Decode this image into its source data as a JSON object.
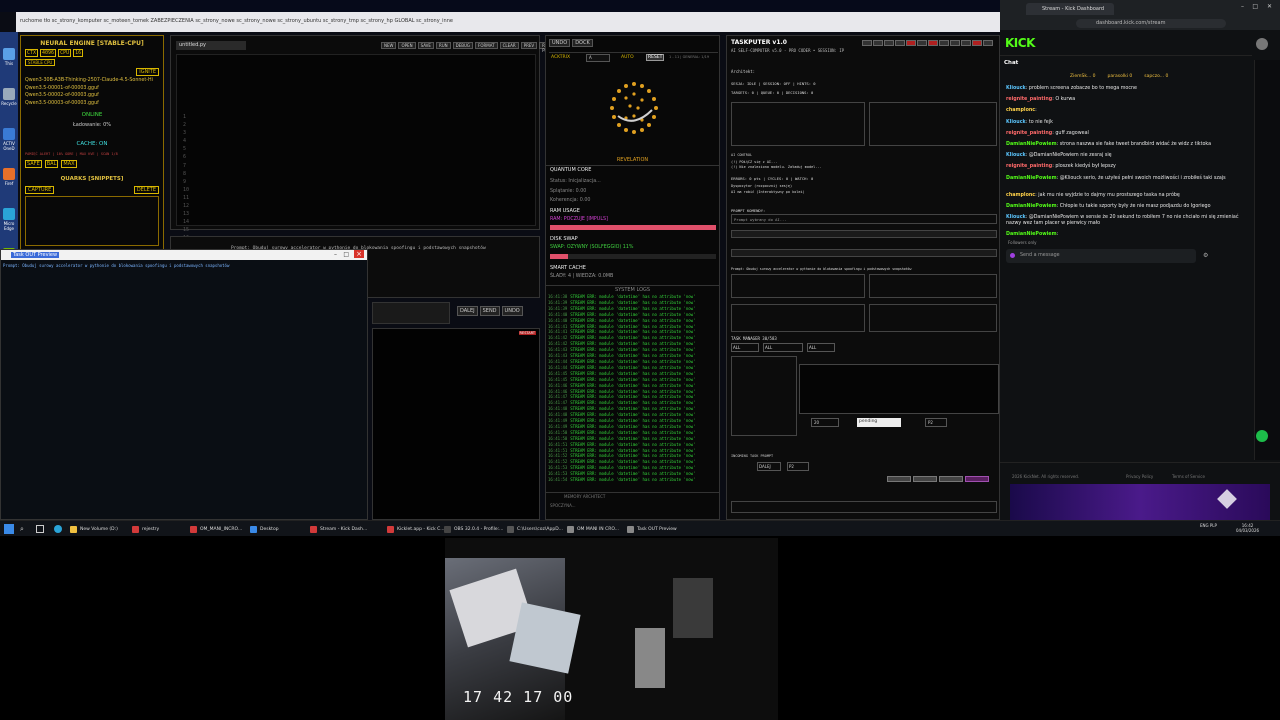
{
  "browser": {
    "bookmark_links": "ruchome tło   sc_strony_komputer   sc_moteen_tomek   ZABEZPIECZENIA   sc_strony_nowe   sc_strony_nowe   sc_strony_ubuntu   sc_strony_tmp   sc_strony_hp   GLOBAL   sc_strony_inne"
  },
  "desktop_icons": [
    {
      "label": "This",
      "color": "#5aa0e8"
    },
    {
      "label": "Recycle",
      "color": "#9ab"
    },
    {
      "label": "ACTIV OneD",
      "color": "#3a7bd5"
    },
    {
      "label": "Firef",
      "color": "#e8702a"
    },
    {
      "label": "Micro Edge",
      "color": "#2aa4d8"
    },
    {
      "label": "NVIDIA",
      "color": "#76b900"
    }
  ],
  "neural": {
    "title": "NEURAL ENGINE [STABLE-CPU]",
    "buttons": [
      "CTX",
      "4096",
      "CPU",
      "16"
    ],
    "stable": "STABLE CPU",
    "ignite": "IGNITE",
    "models": [
      "Qwen3-30B-A3B-Thinking-2507-Claude-4.5-Sonnet-Hi",
      "Qwen3.5-00001-of-00003.gguf",
      "Qwen3.5-00002-of-00003.gguf",
      "Qwen3.5-00003-of-00003.gguf"
    ],
    "status": "ONLINE",
    "loading": "Ładowanie: 0%",
    "cache": "CACHE: ON",
    "cache_stats": "PAMIĘĆ ALERT  |  10% GORE  |  MAX KVE  |  SCAN 1/8",
    "cache_buttons": [
      "SAFE",
      "BAL",
      "MAX"
    ],
    "quarks_title": "QUARKS [SNIPPETS]",
    "capture": "CAPTURE",
    "delete": "DELETE"
  },
  "editor": {
    "tab": "untitled.py",
    "toolbar": [
      "NEW",
      "OPEN",
      "SAVE",
      "RUN",
      "DEBUG",
      "FORMAT",
      "CLEAR",
      "PREV",
      "RUN PROMPT"
    ],
    "line_numbers": "1\n2\n3\n4\n5\n6\n7\n8\n9\n10\n11\n12\n13\n14\n15\n16\n17\n18\n19",
    "prompt_text": "Prompt: Obuduj surowy accelerator w pythonie do blokowania spoofingu i podstawowych snapshotów",
    "nav_buttons": [
      "DALEJ",
      "SEND",
      "UNDO"
    ],
    "restart": "RESTART"
  },
  "preview_window": {
    "title": "Task OUT Preview",
    "controls": [
      "–",
      "□",
      "×"
    ],
    "text": "Prompt: Obuduj surowy accelerator w pythonie do blokowania spoofingu i podstawowych snapshotów"
  },
  "middle": {
    "undo": "UNDO",
    "dock": "DOCK",
    "actrix": "ACKTRIX",
    "auto": "AUTO",
    "reset": "RESET",
    "mode": "A",
    "counts": "1 - 11  |  GENERAL: 1/19",
    "revelation": "REVELATION",
    "quantum_title": "QUANTUM CORE",
    "quantum_lines": [
      "Status: Inicjalizacja...",
      "Splątanie: 0.00",
      "Koherencja: 0.00"
    ],
    "ram_title": "RAM USAGE",
    "ram_value": "RAM: POCZUJE [IMPULS]",
    "swap_title": "DISK SWAP",
    "swap_value": "SWAP: OZYWNY (SOLFEGGIO) 11%",
    "smart_title": "SMART CACHE",
    "smart_value": "ŚLADY: 4  |  WIEDZA: 0.0MB",
    "log_title": "SYSTEM LOGS",
    "log_times": [
      "16:41:38",
      "16:41:39",
      "16:41:39",
      "16:41:40",
      "16:41:40",
      "16:41:41",
      "16:41:41",
      "16:41:42",
      "16:41:42",
      "16:41:43",
      "16:41:43",
      "16:41:44",
      "16:41:44",
      "16:41:45",
      "16:41:45",
      "16:41:46",
      "16:41:46",
      "16:41:47",
      "16:41:47",
      "16:41:48",
      "16:41:48",
      "16:41:49",
      "16:41:49",
      "16:41:50",
      "16:41:50",
      "16:41:51",
      "16:41:51",
      "16:41:52",
      "16:41:52",
      "16:41:53",
      "16:41:53",
      "16:41:54"
    ],
    "log_msg": "STREAM ERR: module 'datetime' has no attribute 'now'",
    "memory_title": "MEMORY ARCHITECT",
    "memory_value": "SPOCZYNA..."
  },
  "taskputer": {
    "title": "TASKPUTER v1.0",
    "sub": "AI SELF-COMPUTER v5.0 - PRO CODER • SESSION: IP",
    "architect": "Architekt:",
    "session_line": "SESJA: IDLE  |  SESSION: OFF  |  HINTS: 0",
    "targets": "TARGETS: 0  |  QUEUE: 0  |  DECISIONS: 0",
    "ai_control": "AI CONTROL",
    "control_lines": [
      "(!) POŁĄCZ się z AI...",
      "(!) Nie znaleziono modelu. Załaduj model..."
    ],
    "errors_line": "ERRORS: 0 pts  |  CYCLES: 0  |  WATCH: 0",
    "dispatch": "Dyspozytor (rozpocznij sesję)",
    "dispatch2": "AI ma robić (Interaktywny po kolei)",
    "prompt_label": "PROMPT KOMENDY:",
    "prompt_value": "Prompt wybrany do AI...",
    "task_manager": "TASK MANAGER 30/583",
    "filters": [
      "ALL",
      "ALL",
      "ALL"
    ],
    "status_input": "pending",
    "priority": "P2",
    "deadline": "20",
    "incoming": "INCOMING TASK PROMPT",
    "priority2": "P2",
    "state": "DALEJ",
    "prompt_long": "Prompt: Obuduj surowy accelerator w pythonie do blokowania spoofingu i podstawowych snapshotów"
  },
  "kick": {
    "tab_title": "Stream - Kick Dashboard",
    "url": "dashboard.kick.com/stream",
    "logo": "KICK",
    "chat_header": "Chat",
    "viewers": [
      "ZiemSk... 0",
      "parasolki 0",
      "sapczo... 0"
    ],
    "messages": [
      {
        "name": "Kliouck",
        "text": "problem screena zobacze bo to mega mocne",
        "color": "#5cc7ff"
      },
      {
        "name": "reignite_painting",
        "text": "O kurwa",
        "color": "#ff6a6a"
      },
      {
        "name": "champlonc",
        "text": "",
        "color": "#ffd24a"
      },
      {
        "name": "Kliouck",
        "text": "to nie fejk",
        "color": "#5cc7ff"
      },
      {
        "name": "reignite_painting",
        "text": "guff zagoweal",
        "color": "#ff6a6a"
      },
      {
        "name": "DamianNiePowiem",
        "text": "strona naszwa sie fake tweet brandbird widać że widz z tiktoka",
        "color": "#53fc18"
      },
      {
        "name": "Kliouck",
        "text": "@DamianNiePowiem nie zesraj się",
        "color": "#5cc7ff"
      },
      {
        "name": "reignite_painting",
        "text": "ploszek kiedyś był lepszy",
        "color": "#ff6a6a"
      },
      {
        "name": "DamianNiePowiem",
        "text": "@Kliouck serio, że użyłeś pełni swoich możliwości i zrobiłeś taki szajs",
        "color": "#53fc18"
      },
      {
        "name": "champlonc",
        "text": "jak mu nie wyjdzie to dajmy mu prostszego taska na próbę",
        "color": "#ffd24a"
      },
      {
        "name": "DamianNiePowiem",
        "text": "Chłopie tu takie szporty były że nie masz podjazdu do Igoriego",
        "color": "#53fc18"
      },
      {
        "name": "Kliouck",
        "text": "@DamianNiePowiem w sensie że 20 sekund to robiłem 7 no nie chciało mi się zmieniać nazwy wez tam placer w pierwicy mało",
        "color": "#5cc7ff"
      },
      {
        "name": "DamianNiePowiem",
        "text": "",
        "color": "#53fc18"
      }
    ],
    "followers_only": "Followers only",
    "send_placeholder": "Send a message",
    "footer": "2026 KickNet. All rights reserved.",
    "footer_links": [
      "Privacy Policy",
      "Terms of Service"
    ]
  },
  "taskbar": {
    "items": [
      {
        "label": "New Volume (D:)",
        "color": "#f0c040"
      },
      {
        "label": "rejestry",
        "color": "#d23a3a"
      },
      {
        "label": "OM_MANI_INCRO...",
        "color": "#d23a3a"
      },
      {
        "label": "Desktop",
        "color": "#3a8ae8"
      },
      {
        "label": "Stream - Kick Dash...",
        "color": "#d23a3a"
      },
      {
        "label": "Kicklet.app - Kick C...",
        "color": "#d23a3a"
      },
      {
        "label": "OBS 32.0.4 - Profile:...",
        "color": "#444"
      },
      {
        "label": "C:\\Users\\coz\\AppD...",
        "color": "#555"
      },
      {
        "label": "OM MANI IN CRO...",
        "color": "#888"
      },
      {
        "label": "Task OUT Preview",
        "color": "#888"
      }
    ],
    "lang": "ENG PLP",
    "time": "16:42",
    "date": "04/03/2026"
  },
  "camera": {
    "overlay_time": "17 42 17 00"
  }
}
